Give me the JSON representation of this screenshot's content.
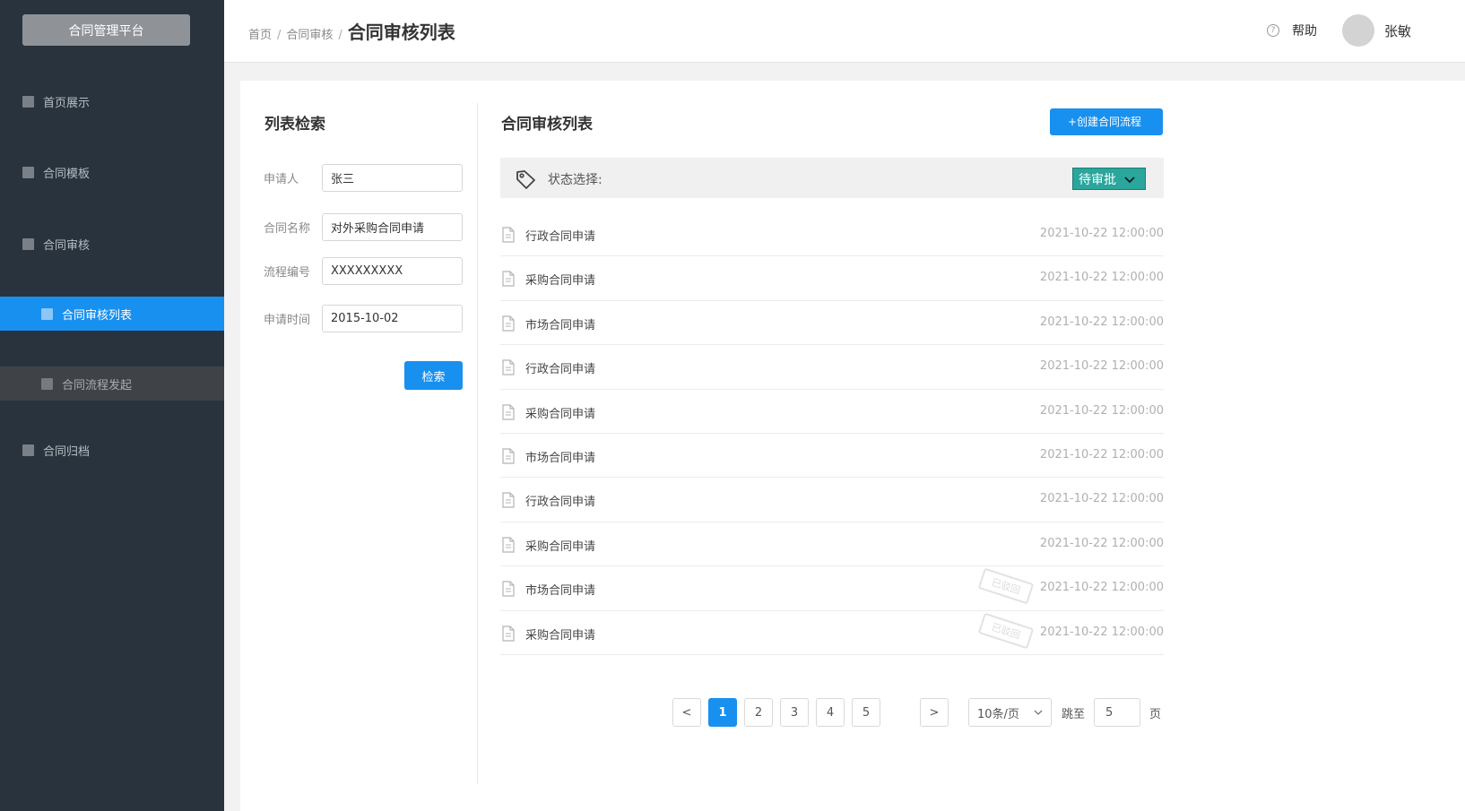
{
  "sidebar": {
    "platform_button": "合同管理平台",
    "items": [
      {
        "label": "首页展示"
      },
      {
        "label": "合同模板"
      },
      {
        "label": "合同审核"
      },
      {
        "label": "合同审核列表"
      },
      {
        "label": "合同流程发起"
      },
      {
        "label": "合同归档"
      }
    ]
  },
  "header": {
    "breadcrumb": [
      "首页",
      "合同审核",
      "合同审核列表"
    ],
    "help_label": "帮助",
    "username": "张敏"
  },
  "search": {
    "title": "列表检索",
    "fields": [
      {
        "label": "申请人",
        "value": "张三"
      },
      {
        "label": "合同名称",
        "value": "对外采购合同申请"
      },
      {
        "label": "流程编号",
        "value": "XXXXXXXXX"
      },
      {
        "label": "申请时间",
        "value": "2015-10-02"
      }
    ],
    "button_label": "检索"
  },
  "list": {
    "title": "合同审核列表",
    "create_button": "+创建合同流程",
    "status_label": "状态选择:",
    "status_selected": "待审批",
    "rows": [
      {
        "name": "行政合同申请",
        "time": "2021-10-22 12:00:00",
        "stamp": ""
      },
      {
        "name": "采购合同申请",
        "time": "2021-10-22 12:00:00",
        "stamp": ""
      },
      {
        "name": "市场合同申请",
        "time": "2021-10-22 12:00:00",
        "stamp": ""
      },
      {
        "name": "行政合同申请",
        "time": "2021-10-22 12:00:00",
        "stamp": ""
      },
      {
        "name": "采购合同申请",
        "time": "2021-10-22 12:00:00",
        "stamp": ""
      },
      {
        "name": "市场合同申请",
        "time": "2021-10-22 12:00:00",
        "stamp": ""
      },
      {
        "name": "行政合同申请",
        "time": "2021-10-22 12:00:00",
        "stamp": ""
      },
      {
        "name": "采购合同申请",
        "time": "2021-10-22 12:00:00",
        "stamp": ""
      },
      {
        "name": "市场合同申请",
        "time": "2021-10-22 12:00:00",
        "stamp": "已驳回"
      },
      {
        "name": "采购合同申请",
        "time": "2021-10-22 12:00:00",
        "stamp": "已驳回"
      }
    ]
  },
  "pagination": {
    "prev": "<",
    "next": ">",
    "pages": [
      "1",
      "2",
      "3",
      "4",
      "5"
    ],
    "current": "1",
    "page_size": "10条/页",
    "jump_label": "跳至",
    "jump_value": "5",
    "page_unit": "页"
  },
  "colors": {
    "sidebar_bg": "#28333d",
    "accent": "#1890f0",
    "status_badge": "#2aa69c"
  },
  "icons": {
    "help": "question-circle-icon",
    "tag": "tag-icon",
    "doc": "document-icon",
    "chevron": "chevron-down-icon"
  }
}
